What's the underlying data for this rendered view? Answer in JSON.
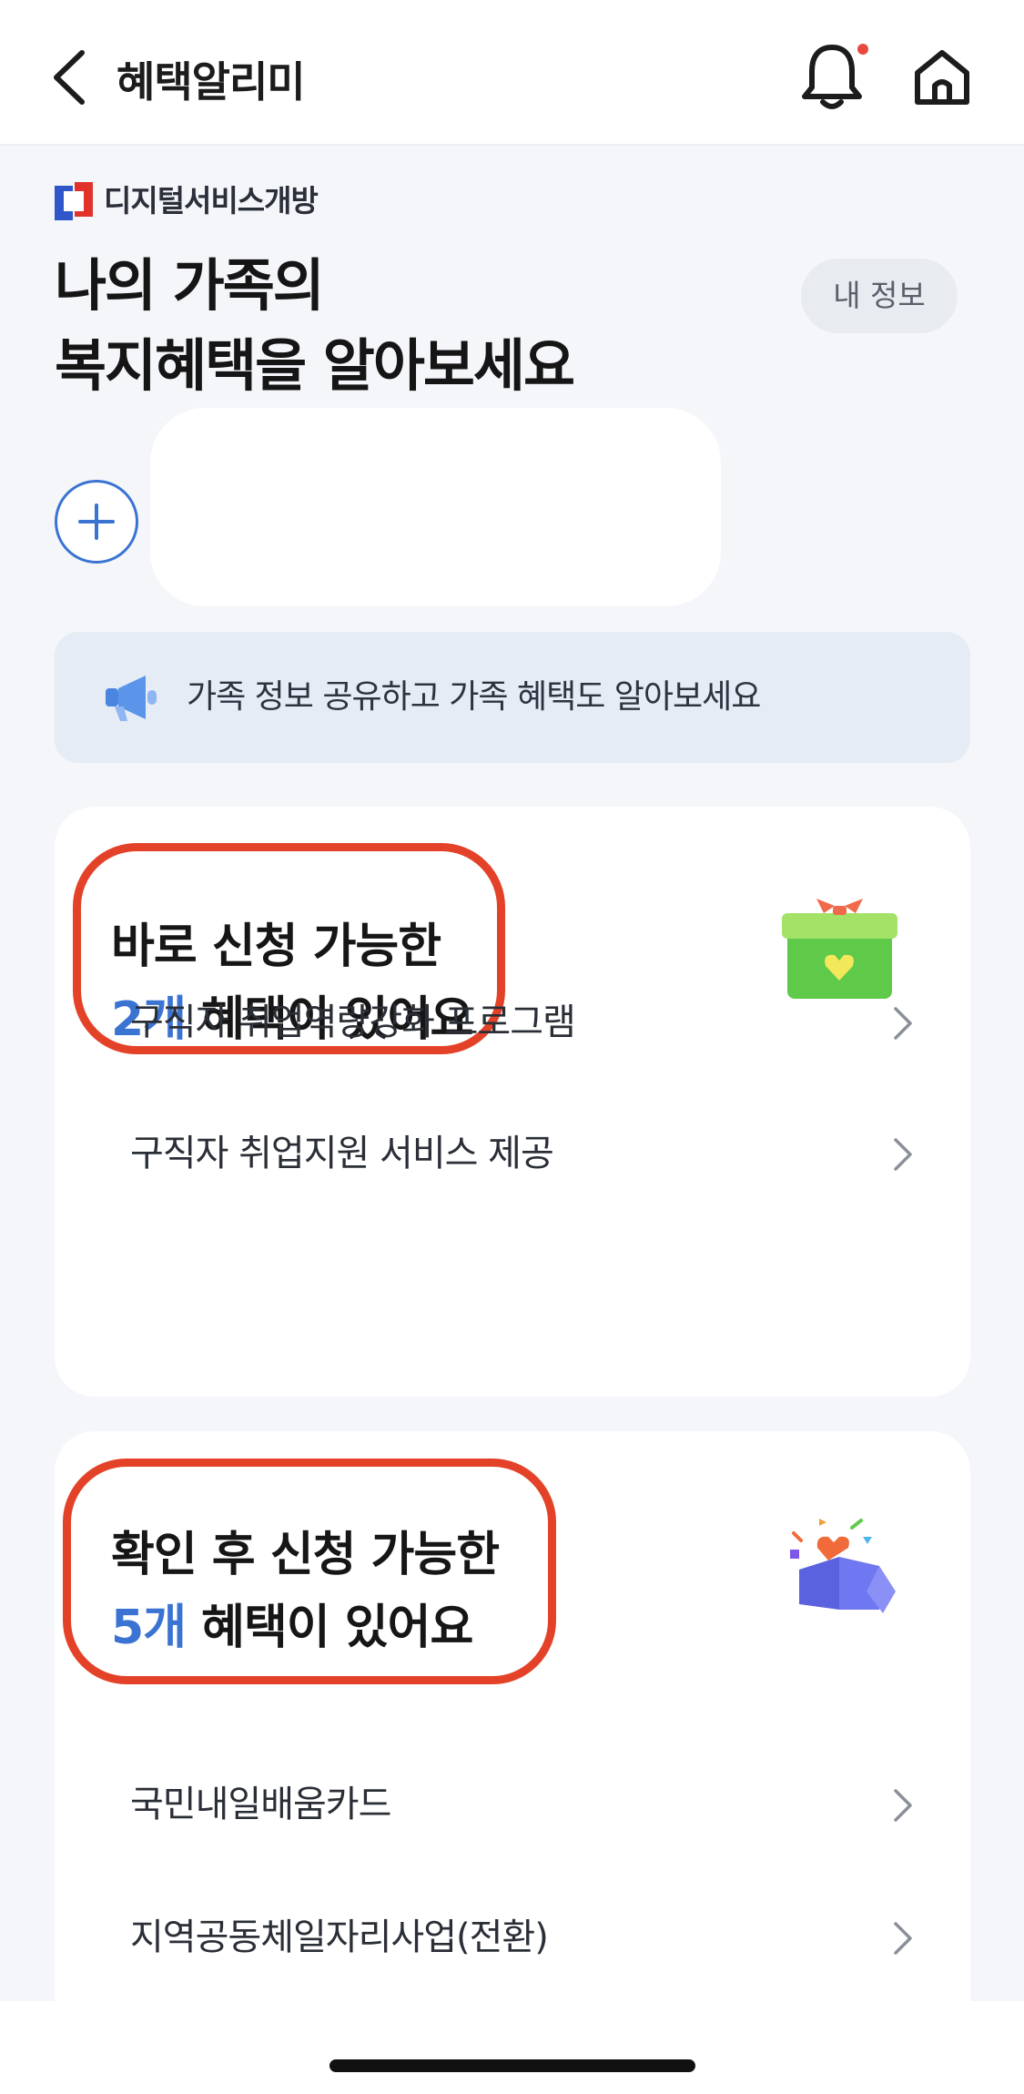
{
  "header": {
    "title": "혜택알리미",
    "back_icon": "chevron-left-icon",
    "bell_icon": "bell-icon",
    "home_icon": "home-icon",
    "notification_dot_color": "#e8493f"
  },
  "brand": {
    "text": "디지털서비스개방",
    "logo_icon": "digital-service-logo-icon"
  },
  "hero": {
    "line1": "나의 가족의",
    "line2": "복지혜택을 알아보세요"
  },
  "my_info_button": "내 정보",
  "add_family_icon": "plus-icon",
  "notice": {
    "icon": "megaphone-icon",
    "text": "가족 정보 공유하고 가족 혜택도 알아보세요"
  },
  "card_now": {
    "title_line1": "바로 신청 가능한",
    "count": "2개",
    "title_line2_rest": " 혜택이 있어요",
    "icon": "gift-box-icon",
    "items": [
      {
        "label": "구직자 취업역량강화 프로그램"
      },
      {
        "label": "구직자 취업지원 서비스 제공"
      }
    ]
  },
  "card_check": {
    "title_line1": "확인 후 신청 가능한",
    "count": "5개",
    "title_line2_rest": " 혜택이 있어요",
    "icon": "open-box-heart-icon",
    "items": [
      {
        "label": "국민내일배움카드"
      },
      {
        "label": "지역공동체일자리사업(전환)"
      }
    ]
  },
  "colors": {
    "accent": "#3a73d2",
    "highlight": "#e34228",
    "background": "#f4f6fa"
  }
}
